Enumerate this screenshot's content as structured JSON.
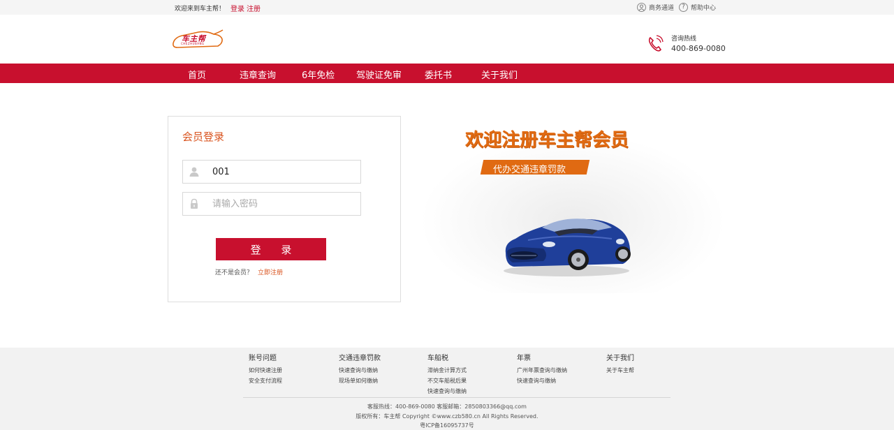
{
  "topbar": {
    "welcome": "欢迎来到车主帮！",
    "login": "登录",
    "register": "注册",
    "business": "商务通道",
    "help": "帮助中心"
  },
  "header": {
    "logo_text": "车主帮",
    "logo_sub": "CHEZHUBANG",
    "hotline_label": "咨询热线",
    "hotline_number": "400-869-0080"
  },
  "nav": {
    "items": [
      {
        "label": "首页"
      },
      {
        "label": "违章查询"
      },
      {
        "label": "6年免检"
      },
      {
        "label": "驾驶证免审"
      },
      {
        "label": "委托书"
      },
      {
        "label": "关于我们"
      }
    ]
  },
  "login_form": {
    "title": "会员登录",
    "username_value": "001",
    "password_placeholder": "请输入密码",
    "submit_label": "登 录",
    "not_member": "还不是会员？",
    "register_now": "立即注册"
  },
  "promo": {
    "title": "欢迎注册车主帮会员",
    "tagline": "代办交通违章罚款"
  },
  "footer": {
    "columns": [
      {
        "heading": "账号问题",
        "links": [
          "如何快速注册",
          "安全支付流程"
        ]
      },
      {
        "heading": "交通违章罚款",
        "links": [
          "快速查询与缴纳",
          "现场单如何缴纳"
        ]
      },
      {
        "heading": "车船税",
        "links": [
          "滞纳金计算方式",
          "不交车船税后果",
          "快速查询与缴纳"
        ]
      },
      {
        "heading": "年票",
        "links": [
          "广州年票查询与缴纳",
          "快速查询与缴纳"
        ]
      },
      {
        "heading": "关于我们",
        "links": [
          "关于车主帮"
        ]
      }
    ],
    "service_line": "客服热线：400-869-0080   客服邮箱：2850803366@qq.com",
    "copyright": "版权所有：车主帮 Copyright ©www.czb580.cn All Rights Reserved.",
    "icp": "粤ICP备16095737号"
  },
  "colors": {
    "brand_red": "#c8102e",
    "accent_orange": "#e06a12",
    "car_blue": "#1f3f9a"
  }
}
